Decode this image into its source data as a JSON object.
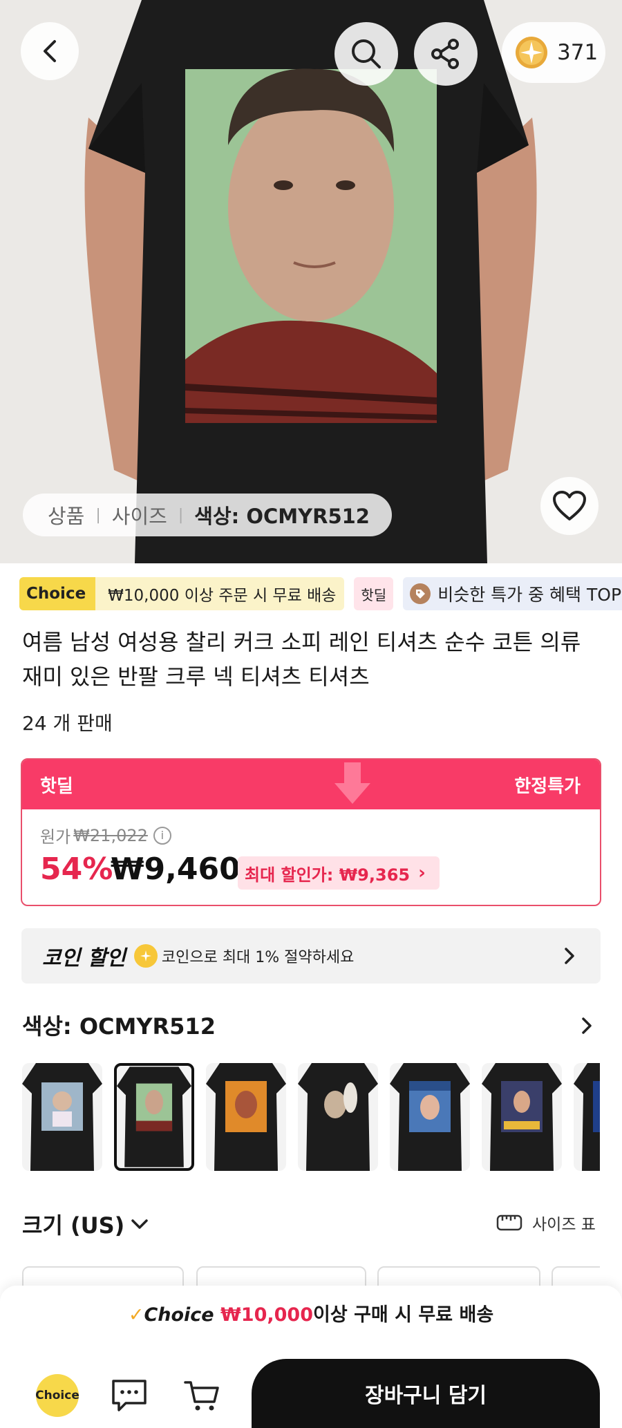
{
  "header": {
    "back_icon": "chevron-left-icon",
    "search_icon": "search-icon",
    "share_icon": "share-icon",
    "coin_count": "371"
  },
  "hero_tabs": {
    "product": "상품",
    "size": "사이즈",
    "color": "색상: OCMYR512"
  },
  "tags": {
    "choice_logo": "Choice",
    "choice_text": "₩10,000 이상 주문 시 무료 배송",
    "hotdeal": "핫딜",
    "top_text": "비슷한 특가 중 혜택 TOP 상"
  },
  "product": {
    "title": "여름 남성 여성용 찰리 커크 소피 레인 티셔츠 순수 코튼 의류 재미 있은 반팔 크루 넥 티셔츠 티셔츠",
    "sold": "24 개 판매"
  },
  "price": {
    "header_left": "핫딜",
    "header_right": "한정특가",
    "original_label": "원가",
    "original_price": "₩21,022",
    "discount": "54%",
    "sale_price": "₩9,460",
    "max_discount": "최대 할인가: ₩9,365"
  },
  "coin_discount": {
    "label": "코인 할인",
    "text": "코인으로 최대 1% 절약하세요"
  },
  "color": {
    "label": "색상: OCMYR512",
    "selected_index": 1,
    "swatch_count": 7
  },
  "size": {
    "label": "크기 (US)",
    "chart": "사이즈 표"
  },
  "bottom": {
    "promo_check": "✓",
    "promo_choice": "Choice",
    "promo_amount": "₩10,000",
    "promo_rest": "이상 구매 시 무료 배송",
    "choice_logo": "Choice",
    "add_to_cart": "장바구니 담기"
  },
  "colors": {
    "hot_pink": "#f83b67",
    "discount_red": "#e6264e",
    "choice_yellow": "#f7d84a"
  }
}
